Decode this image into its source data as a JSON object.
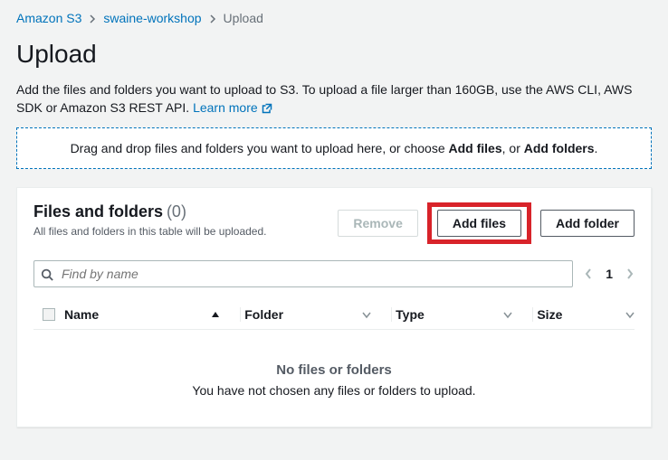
{
  "breadcrumb": {
    "items": [
      {
        "label": "Amazon S3",
        "link": true
      },
      {
        "label": "swaine-workshop",
        "link": true
      },
      {
        "label": "Upload",
        "link": false
      }
    ]
  },
  "heading": "Upload",
  "intro": {
    "text": "Add the files and folders you want to upload to S3. To upload a file larger than 160GB, use the AWS CLI, AWS SDK or Amazon S3 REST API.",
    "learn_more": "Learn more"
  },
  "dropzone": {
    "prefix": "Drag and drop files and folders you want to upload here, or choose ",
    "add_files": "Add files",
    "sep1": ", or ",
    "add_folders": "Add folders",
    "suffix": "."
  },
  "panel": {
    "title": "Files and folders",
    "count_display": "(0)",
    "description": "All files and folders in this table will be uploaded.",
    "buttons": {
      "remove": "Remove",
      "add_files": "Add files",
      "add_folder": "Add folder"
    },
    "search": {
      "placeholder": "Find by name"
    },
    "pagination": {
      "page": "1"
    },
    "columns": {
      "name": "Name",
      "folder": "Folder",
      "type": "Type",
      "size": "Size"
    },
    "empty": {
      "title": "No files or folders",
      "subtitle": "You have not chosen any files or folders to upload."
    }
  }
}
